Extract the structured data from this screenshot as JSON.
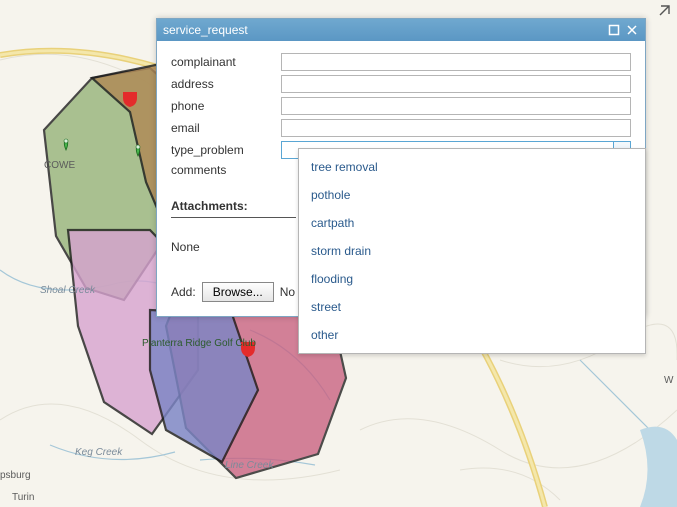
{
  "dialog": {
    "title": "service_request",
    "fields": {
      "complainant": {
        "label": "complainant",
        "value": ""
      },
      "address": {
        "label": "address",
        "value": ""
      },
      "phone": {
        "label": "phone",
        "value": ""
      },
      "email": {
        "label": "email",
        "value": ""
      },
      "type_problem": {
        "label": "type_problem",
        "value": ""
      },
      "comments": {
        "label": "comments",
        "value": ""
      }
    },
    "attachments": {
      "heading": "Attachments:",
      "none_text": "None",
      "add_label": "Add:",
      "browse_label": "Browse...",
      "file_status": "No"
    }
  },
  "type_problem_options": [
    "tree removal",
    "pothole",
    "cartpath",
    "storm drain",
    "flooding",
    "street",
    "other"
  ],
  "map_labels": {
    "shoal_creek": "Shoal Creek",
    "keg_creek": "Keg Creek",
    "line_creek": "Line Creek",
    "coweta": "COWE",
    "golf_club": "Planterra Ridge Golf Club",
    "psburg": "psburg",
    "turin": "Turin",
    "w_label": "W"
  }
}
